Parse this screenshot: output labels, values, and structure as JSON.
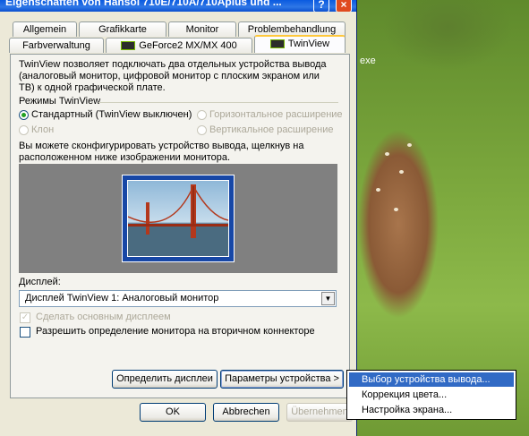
{
  "window": {
    "title": "Eigenschaften von Hansol 710E/710A/710Aplus und ...",
    "help_glyph": "?",
    "close_glyph": "×"
  },
  "desktop": {
    "label": "exe"
  },
  "tabs_row1": [
    "Allgemein",
    "Grafikkarte",
    "Monitor",
    "Problembehandlung"
  ],
  "tabs_row2": {
    "color": "Farbverwaltung",
    "geforce": "GeForce2 MX/MX 400",
    "twinview": "TwinView"
  },
  "panel": {
    "description": [
      "TwinView позволяет подключать два отдельных устройства вывода",
      "(аналоговый монитор, цифровой монитор с плоским экраном или",
      "ТВ) к одной графической плате."
    ],
    "modes_title": "Режимы TwinView",
    "modes": {
      "standard": "Стандартный (TwinView выключен)",
      "horizontal": "Горизонтальное расширение",
      "clone": "Клон",
      "vertical": "Вертикальное расширение"
    },
    "configure_hint": [
      "Вы можете сконфигурировать устройство вывода, щелкнув на",
      "расположенном ниже изображении монитора."
    ],
    "display_label": "Дисплей:",
    "display_value": "Дисплей TwinView 1: Аналоговый монитор",
    "make_primary": "Сделать основным дисплеем",
    "allow_detect": "Разрешить определение монитора на вторичном коннекторе",
    "identify_button": "Определить дисплеи",
    "device_settings_button": "Параметры устройства >"
  },
  "buttons": {
    "ok": "OK",
    "cancel": "Abbrechen",
    "apply": "Übernehmen"
  },
  "context_menu": {
    "items": [
      "Выбор устройства вывода...",
      "Коррекция цвета...",
      "Настройка экрана..."
    ]
  },
  "colors": {
    "title_blue": "#0a5ae0",
    "menu_highlight": "#316ac5",
    "preview_gray": "#808080",
    "monitor_blue": "#1747a6"
  }
}
